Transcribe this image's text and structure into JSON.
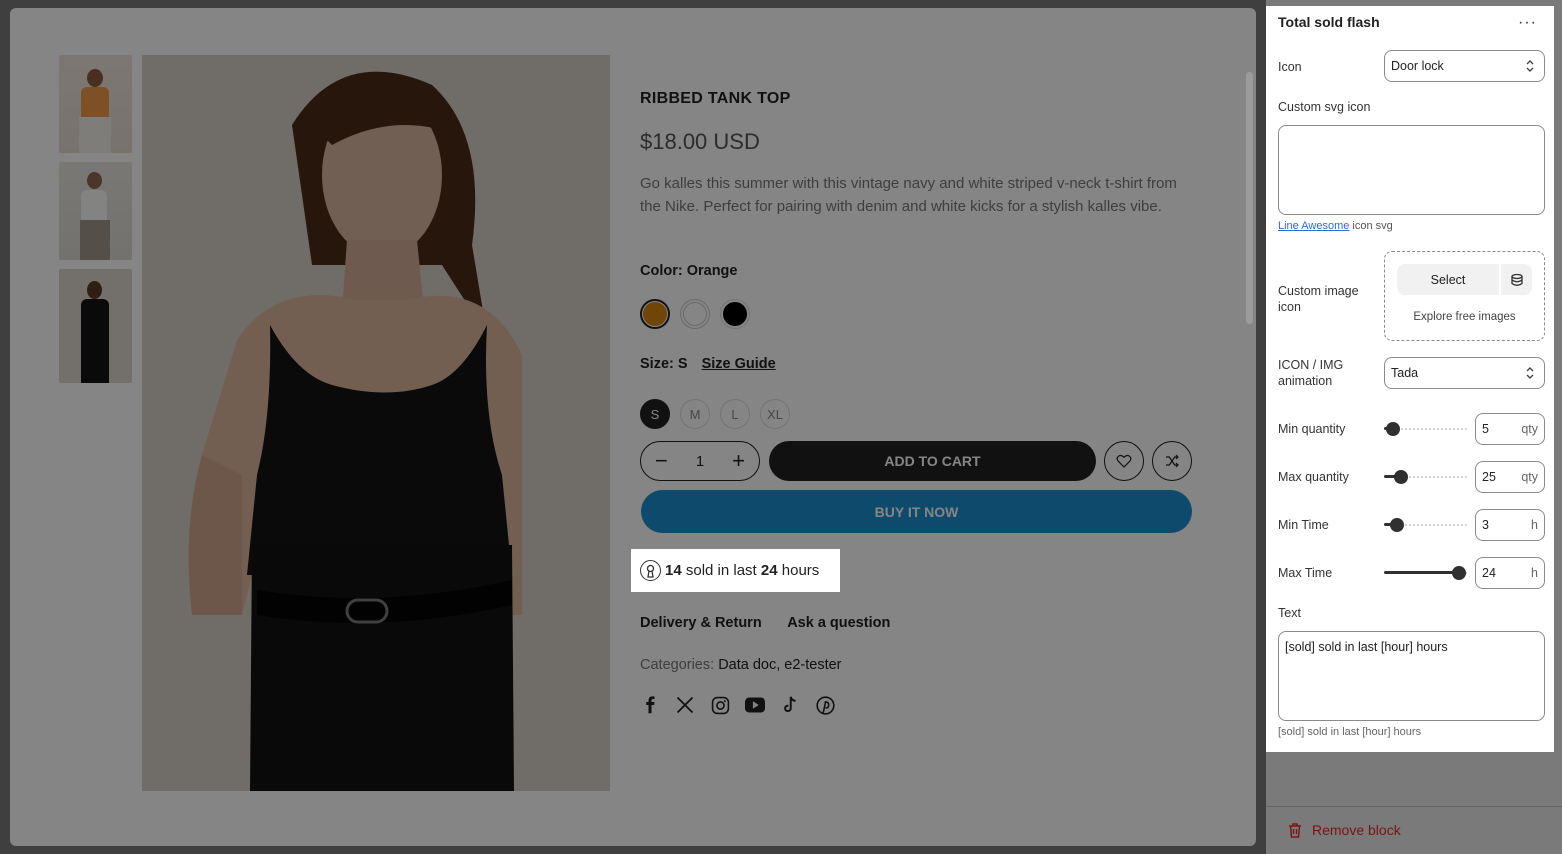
{
  "product": {
    "title": "RIBBED TANK TOP",
    "price": "$18.00 USD",
    "description": "Go kalles this summer with this vintage navy and white striped v-neck t-shirt from the Nike. Perfect for pairing with denim and white kicks for a stylish kalles vibe.",
    "color_label": "Color: Orange",
    "color_swatches": [
      {
        "name": "Orange",
        "hex": "#d9820f",
        "selected": true
      },
      {
        "name": "White",
        "hex": "#ffffff",
        "selected": false
      },
      {
        "name": "Black",
        "hex": "#000000",
        "selected": false
      }
    ],
    "size_label": "Size: S",
    "size_guide": "Size Guide",
    "sizes": [
      "S",
      "M",
      "L",
      "XL"
    ],
    "selected_size": "S",
    "quantity": "1",
    "qty_minus": "−",
    "qty_plus": "+",
    "add_to_cart": "ADD TO CART",
    "buy_now": "BUY IT NOW",
    "sold_count": "14",
    "sold_middle": " sold in last ",
    "sold_hours": "24",
    "sold_suffix": " hours",
    "tabs": [
      "Delivery & Return",
      "Ask a question"
    ],
    "categories_label": "Categories: ",
    "categories_value": "Data doc, e2-tester",
    "social_icons": [
      "facebook-icon",
      "x-icon",
      "instagram-icon",
      "youtube-icon",
      "tiktok-icon",
      "pinterest-icon"
    ],
    "accent_color": "#1b8fcf"
  },
  "panel": {
    "title": "Total sold flash",
    "more_label": "···",
    "icon_label": "Icon",
    "icon_value": "Door lock",
    "custom_svg_label": "Custom svg icon",
    "custom_svg_value": "",
    "link_text": "Line Awesome",
    "link_suffix": " icon svg",
    "custom_image_label": "Custom image icon",
    "select_label": "Select",
    "explore_label": "Explore free images",
    "animation_label": "ICON / IMG animation",
    "animation_value": "Tada",
    "min_qty_label": "Min quantity",
    "min_qty_value": "5",
    "max_qty_label": "Max quantity",
    "max_qty_value": "25",
    "qty_unit": "qty",
    "min_time_label": "Min Time",
    "min_time_value": "3",
    "max_time_label": "Max Time",
    "max_time_value": "24",
    "time_unit": "h",
    "text_label": "Text",
    "text_value": "[sold] sold in last [hour] hours",
    "text_helper": "[sold] sold in last [hour] hours",
    "remove_label": "Remove block"
  }
}
